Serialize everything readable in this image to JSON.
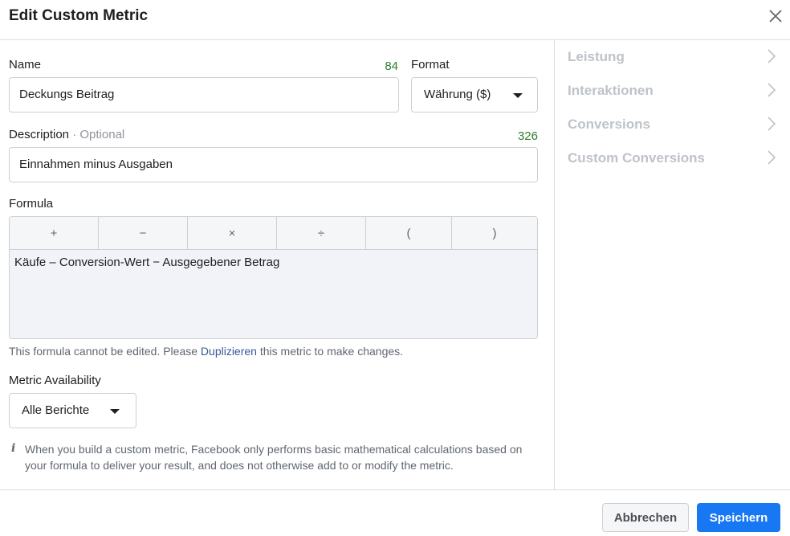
{
  "dialog": {
    "title": "Edit Custom Metric"
  },
  "name": {
    "label": "Name",
    "counter": "84",
    "value": "Deckungs Beitrag"
  },
  "format": {
    "label": "Format",
    "selected": "Währung ($)"
  },
  "description": {
    "label": "Description",
    "separator": " · ",
    "optional": "Optional",
    "counter": "326",
    "value": "Einnahmen minus Ausgaben"
  },
  "formula": {
    "label": "Formula",
    "operators": [
      "+",
      "−",
      "×",
      "÷",
      "(",
      ")"
    ],
    "text": "Käufe – Conversion-Wert − Ausgegebener Betrag",
    "note_before": "This formula cannot be edited. Please ",
    "note_link": "Duplizieren",
    "note_after": " this metric to make changes."
  },
  "availability": {
    "label": "Metric Availability",
    "selected": "Alle Berichte"
  },
  "info": {
    "icon": "i",
    "text": "When you build a custom metric, Facebook only performs basic mathematical calculations based on your formula to deliver your result, and does not otherwise add to or modify the metric."
  },
  "sidebar": {
    "items": [
      {
        "label": "Leistung"
      },
      {
        "label": "Interaktionen"
      },
      {
        "label": "Conversions"
      },
      {
        "label": "Custom Conversions"
      }
    ]
  },
  "footer": {
    "cancel_label": "Abbrechen",
    "save_label": "Speichern"
  },
  "colors": {
    "accent": "#1877f2",
    "counter": "#2e7d32",
    "link": "#385898",
    "disabled_text": "#bec3c9"
  }
}
